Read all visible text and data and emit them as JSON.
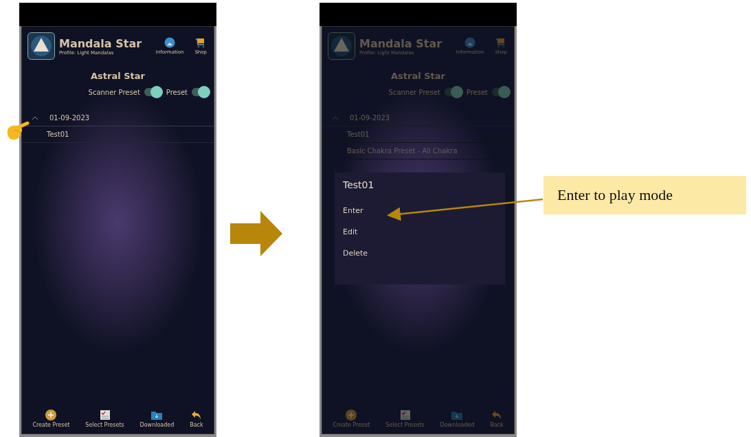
{
  "screens": [
    {
      "dimmed": false,
      "pointer": true,
      "header": {
        "title": "Mandala Star",
        "profile": "Profile: Light Mandalas",
        "actions": [
          {
            "label": "Information",
            "kind": "globe"
          },
          {
            "label": "Shop",
            "kind": "cart"
          }
        ]
      },
      "page_title": "Astral Star",
      "toggles": [
        {
          "label": "Scanner Preset",
          "on": true
        },
        {
          "label": "Preset",
          "on": true
        }
      ],
      "group": {
        "date": "01-09-2023",
        "expanded": true,
        "items": [
          "Test01"
        ]
      },
      "nav": [
        {
          "label": "Create Preset",
          "kind": "create"
        },
        {
          "label": "Select Presets",
          "kind": "select"
        },
        {
          "label": "Downloaded",
          "kind": "download"
        },
        {
          "label": "Back",
          "kind": "back"
        }
      ]
    },
    {
      "dimmed": true,
      "header": {
        "title": "Mandala Star",
        "profile": "Profile: Light Mandalas",
        "actions": [
          {
            "label": "Information",
            "kind": "globe"
          },
          {
            "label": "Shop",
            "kind": "cart"
          }
        ]
      },
      "page_title": "Astral Star",
      "toggles": [
        {
          "label": "Scanner Preset",
          "on": true
        },
        {
          "label": "Preset",
          "on": true
        }
      ],
      "group": {
        "date": "01-09-2023",
        "expanded": true,
        "items": [
          "Test01",
          "Basic Chakra Preset - All Chakra"
        ]
      },
      "dialog": {
        "title": "Test01",
        "options": [
          "Enter",
          "Edit",
          "Delete"
        ]
      },
      "nav": [
        {
          "label": "Create Preset",
          "kind": "create"
        },
        {
          "label": "Select Presets",
          "kind": "select"
        },
        {
          "label": "Downloaded",
          "kind": "download"
        },
        {
          "label": "Back",
          "kind": "back"
        }
      ]
    }
  ],
  "callout": {
    "text": "Enter to play mode"
  }
}
